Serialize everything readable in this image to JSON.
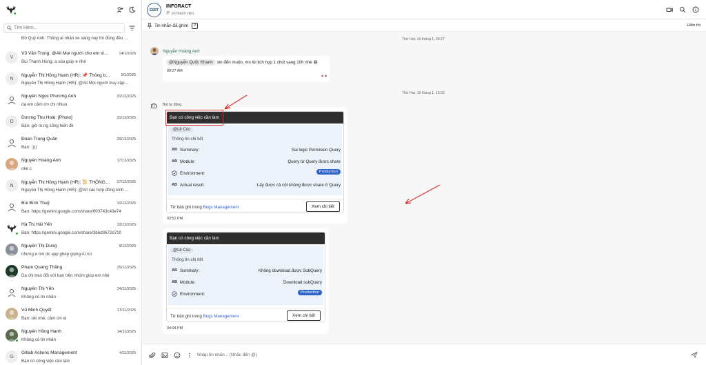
{
  "sidebar": {
    "search_placeholder": "Tìm kiếm...",
    "conversations": [
      {
        "name": "",
        "date": "",
        "msg": "Đỗ Quý Anh: Thông ái nhận xe sáng nay thì đúng đều ...",
        "avatar": "",
        "first": true
      },
      {
        "name": "Vũ Văn Trọng: @All Mọi người cho em xin l...",
        "date": "14/1/2026",
        "msg": "Bùi Thanh Hùng: a xóa giúp e nhé",
        "avatar": "V"
      },
      {
        "name": "Nguyễn Thị Hồng Hạnh (HR): 📌 Thông bá...",
        "date": "9/1/2026",
        "msg": "Nguyễn Thị Hồng Hạnh (HR): @All Mọi người truy cập...",
        "avatar": "N"
      },
      {
        "name": "Nguyễn Ngọc Phương Anh",
        "date": "31/12/2025",
        "msg": "dạ em cảm ơn chị nhiuu",
        "avatar": "user"
      },
      {
        "name": "Dương Thu Hoài: [Photo]",
        "date": "31/12/2025",
        "msg": "Bạn: giờ m.ng cống hiến đk",
        "avatar": "D"
      },
      {
        "name": "Đoàn Trọng Quân",
        "date": "26/12/2025",
        "msg": "Bạn: :)))",
        "avatar": "user"
      },
      {
        "name": "Nguyễn Hoàng Anh",
        "date": "17/12/2025",
        "msg": "oke c",
        "avatar": "photo1"
      },
      {
        "name": "Nguyễn Thị Hồng Hạnh (HR): 📜 THÔNG B...",
        "date": "17/12/2025",
        "msg": "Nguyễn Thị Hồng Hạnh (HR): @All các hợp đồng kinh ...",
        "avatar": "N"
      },
      {
        "name": "Bùi Bích Thuỷ",
        "date": "10/12/2025",
        "msg": "Bạn: https://gemini.google.com/share/603743c43e74",
        "avatar": "user"
      },
      {
        "name": "Hà Thị Hải Yến",
        "date": "10/12/2025",
        "msg": "Bạn: https://gemini.google.com/share/3b6d3672d710",
        "avatar": "deer",
        "online": true
      },
      {
        "name": "Nguyễn Thị Dung",
        "date": "9/12/2025",
        "msg": "nhưng e tìm dc app ghép giọng AI rùi",
        "avatar": "photo2"
      },
      {
        "name": "Phạm Quang Thắng",
        "date": "25/11/2025",
        "msg": "Dạ chị trao đổi với bạn trên nhóm giúp em nhé",
        "avatar": "photo3"
      },
      {
        "name": "Nguyễn Thị Yến",
        "date": "24/11/2025",
        "msg": "Không có tin nhắn",
        "avatar": "user"
      },
      {
        "name": "Vũ Minh Quyết",
        "date": "17/11/2025",
        "msg": "Bạn: oki nhé, cảm ơn ei",
        "avatar": "photo4"
      },
      {
        "name": "Nguyễn Hồng Hạnh",
        "date": "14/11/2025",
        "msg": "Không có tin nhắn",
        "avatar": "photo5",
        "online": true
      },
      {
        "name": "Gitlab Actions Management",
        "date": "4/11/2025",
        "msg": "Bạn có công việc cần làm",
        "avatar": "G"
      }
    ]
  },
  "header": {
    "group_avatar": "ESBT",
    "group_name": "INFORACT",
    "members": "10 thành viên"
  },
  "pinned": {
    "label": "Tin nhắn đã ghim",
    "count": "2",
    "show": "Hiển thị"
  },
  "messages": {
    "day1": "Thứ Hai, 19 tháng 1, 09:27",
    "sender1": "Nguyễn Hoàng Anh",
    "mention1": "@Nguyễn Quốc Khanh",
    "text1": "xin đến muộn, mn lùi lịch họp 1 chút sang 10h nhé 😀",
    "time1": "09:27 AM",
    "reaction": "4",
    "day2": "Thứ Hai, 19 tháng 1, 15:52",
    "bot_label": "Bot tự động",
    "card1": {
      "title": "Bạn có công việc cần làm",
      "assignee": "@Lê Cúc",
      "detail": "Thông tin chi tiết",
      "summary_label": "Summary:",
      "summary": "Sai logic Permision Query",
      "module_label": "Module:",
      "module": "Query từ Query được share",
      "env_label": "Environment:",
      "env": "Production",
      "result_label": "Actual result:",
      "result": "Lấy được cả cột không được share ở Query",
      "foot_prefix": "Từ bản ghi trong",
      "foot_link": "Bugs Management",
      "button": "Xem chi tiết",
      "time": "03:52 PM"
    },
    "card2": {
      "title": "Bạn có công việc cần làm",
      "assignee": "@Lê Cúc",
      "detail": "Thông tin chi tiết",
      "summary_label": "Summary:",
      "summary": "Không download được SubQuery",
      "module_label": "Module:",
      "module": "Download subQuery",
      "env_label": "Environment:",
      "env": "Production",
      "foot_prefix": "Từ bản ghi trong",
      "foot_link": "Bugs Management",
      "button": "Xem chi tiết",
      "time": "04:04 PM"
    },
    "ab": "AB"
  },
  "composer": {
    "placeholder": "Nhập tin nhắn... (Nhắc đến @)"
  },
  "colors": {
    "accent": "#2d62c9",
    "card_header": "#2f2f2f",
    "highlight": "#e03131",
    "online": "#2fb344"
  }
}
